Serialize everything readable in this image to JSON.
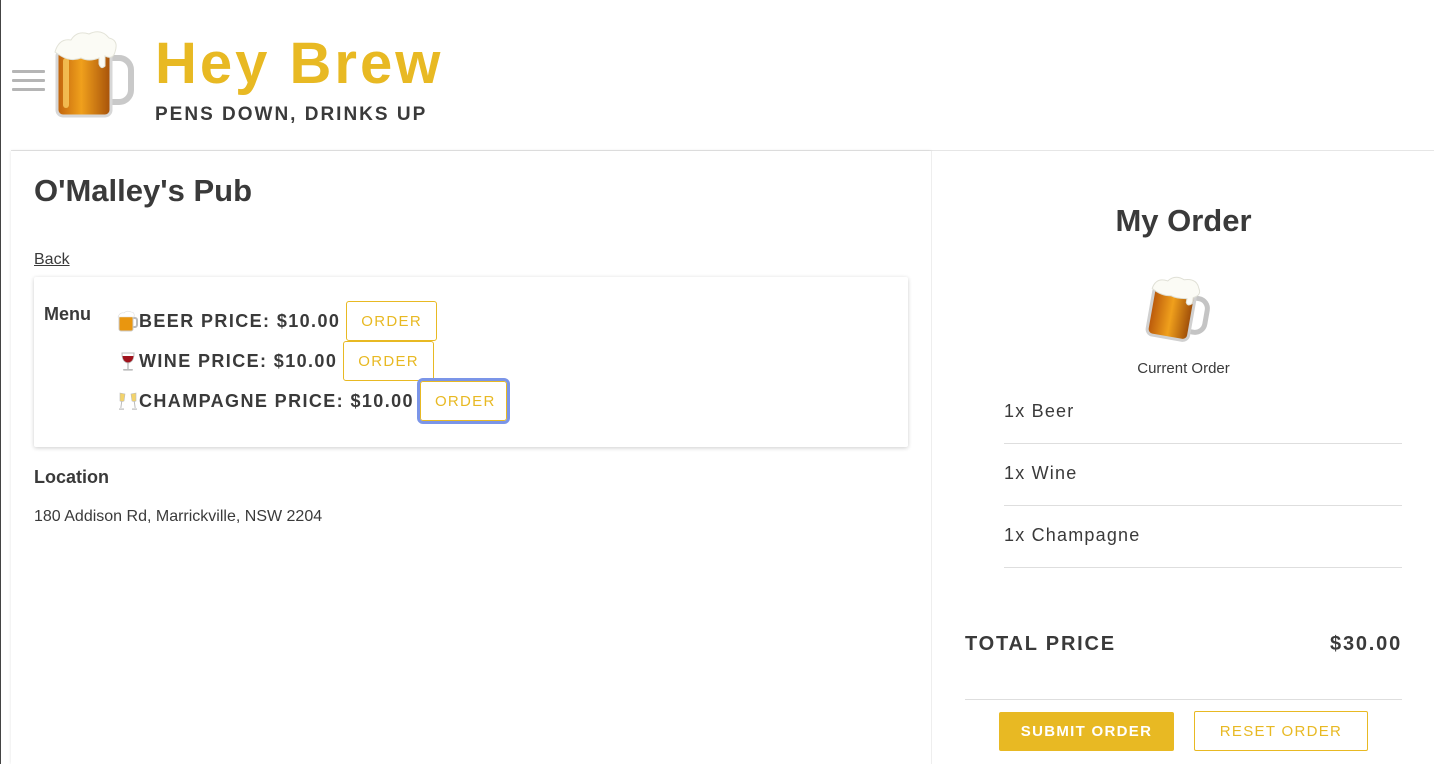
{
  "header": {
    "title": "Hey Brew",
    "tagline": "PENS DOWN, DRINKS UP",
    "menu_icon": "hamburger-icon",
    "logo_icon": "beer-mug-icon"
  },
  "pub": {
    "name": "O'Malley's Pub",
    "back_label": "Back",
    "menu_label": "Menu",
    "items": [
      {
        "icon": "beer-mug-icon",
        "label": "BEER PRICE: $10.00",
        "button": "ORDER"
      },
      {
        "icon": "wine-glass-icon",
        "label": "WINE PRICE: $10.00",
        "button": "ORDER"
      },
      {
        "icon": "champagne-glasses-icon",
        "label": "CHAMPAGNE PRICE: $10.00",
        "button": "ORDER"
      }
    ],
    "location_title": "Location",
    "location_text": "180 Addison Rd, Marrickville, NSW 2204"
  },
  "order": {
    "title": "My Order",
    "icon": "beer-mug-icon",
    "caption": "Current Order",
    "items": [
      "1x Beer",
      "1x Wine",
      "1x Champagne"
    ],
    "total_label": "TOTAL PRICE",
    "total_value": "$30.00",
    "submit_label": "SUBMIT ORDER",
    "reset_label": "RESET ORDER"
  },
  "colors": {
    "accent": "#e8b923",
    "text": "#3a3a3a",
    "focus_ring": "#7b95e8"
  }
}
